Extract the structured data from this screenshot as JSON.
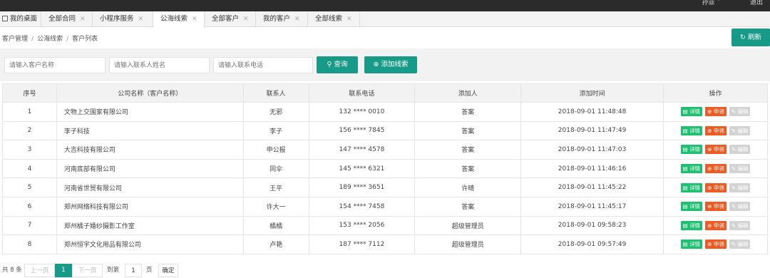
{
  "topbar": {
    "user": "孙亚 ˇ",
    "logout": "退出"
  },
  "tabs": [
    {
      "label": "我的桌面",
      "closable": false,
      "active": false
    },
    {
      "label": "全部合同",
      "closable": true,
      "active": false
    },
    {
      "label": "小程序服务",
      "closable": true,
      "active": false
    },
    {
      "label": "公海线索",
      "closable": true,
      "active": true
    },
    {
      "label": "全部客户",
      "closable": true,
      "active": false
    },
    {
      "label": "我的客户",
      "closable": true,
      "active": false
    },
    {
      "label": "全部线索",
      "closable": true,
      "active": false
    }
  ],
  "breadcrumb": [
    "客户管理",
    "公海线索",
    "客户列表"
  ],
  "refresh_label": "刷新",
  "filters": {
    "company_placeholder": "请输入客户名称",
    "contact_placeholder": "请输入联系人姓名",
    "phone_placeholder": "请输入联系电话",
    "search_label": "查询",
    "add_label": "添加线索"
  },
  "table": {
    "headers": [
      "序号",
      "公司名称（客户名称）",
      "联系人",
      "联系电话",
      "添加人",
      "添加时间",
      "操作"
    ],
    "rows": [
      [
        "1",
        "文物上交国家有限公司",
        "无邪",
        "132 **** 0010",
        "答案",
        "2018-09-01 11:48:48"
      ],
      [
        "2",
        "李子科技",
        "李子",
        "156 **** 7845",
        "答案",
        "2018-09-01 11:47:49"
      ],
      [
        "3",
        "大吉科技有限公司",
        "申公报",
        "147 **** 4578",
        "答案",
        "2018-09-01 11:47:03"
      ],
      [
        "4",
        "河南底部有限公司",
        "同伞",
        "145 **** 6321",
        "答案",
        "2018-09-01 11:46:16"
      ],
      [
        "5",
        "河南省世贸有限公司",
        "王平",
        "189 **** 3651",
        "许晴",
        "2018-09-01 11:45:22"
      ],
      [
        "6",
        "郑州网络科技有限公司",
        "许大一",
        "154 **** 7458",
        "答案",
        "2018-09-01 11:45:17"
      ],
      [
        "7",
        "郑州橘子婚纱摄影工作室",
        "橘橘",
        "153 **** 2056",
        "超级管理员",
        "2018-09-01 09:58:23"
      ],
      [
        "8",
        "郑州恒宇文化用品有限公司",
        "卢艳",
        "187 **** 7112",
        "超级管理员",
        "2018-09-01 09:57:49"
      ]
    ],
    "actions": {
      "detail": "详情",
      "apply": "申领",
      "edit": "编辑"
    }
  },
  "pager": {
    "total": "共 8 条",
    "prev": "上一页",
    "current": "1",
    "next": "下一页",
    "goto": "到第",
    "page_value": "1",
    "page_unit": "页",
    "confirm": "确定"
  }
}
